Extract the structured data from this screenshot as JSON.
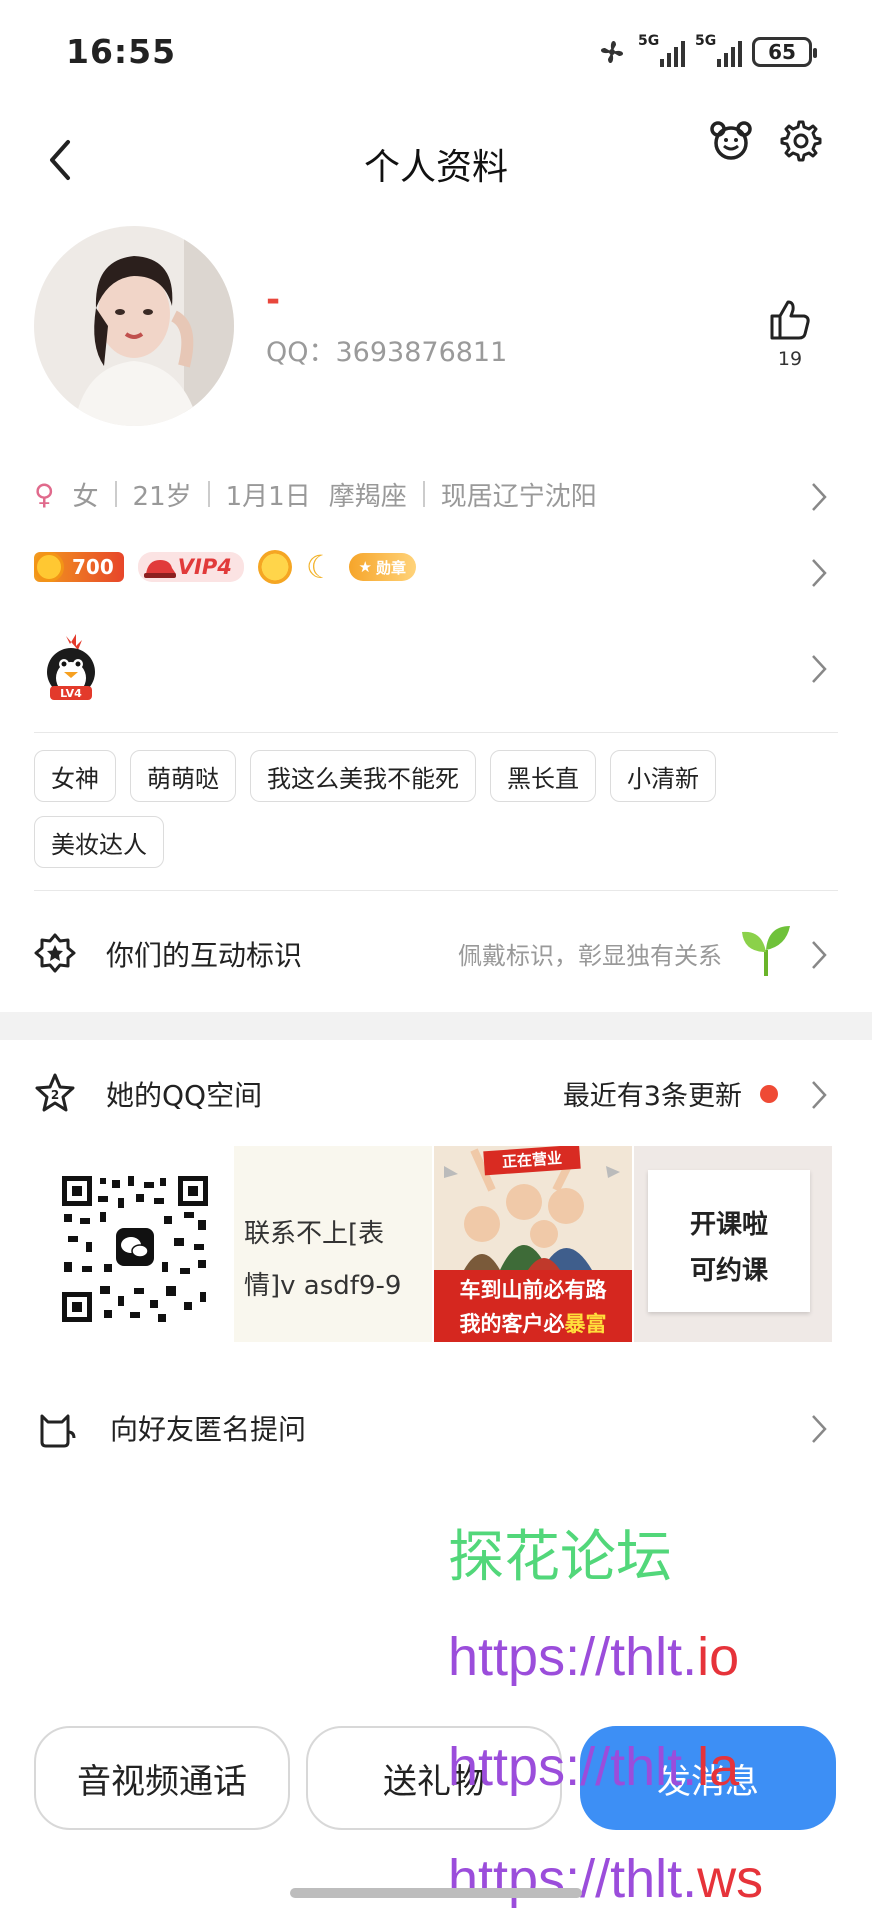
{
  "status_bar": {
    "time": "16:55",
    "network1": "5G",
    "network2": "5G",
    "battery": "65"
  },
  "nav": {
    "title": "个人资料"
  },
  "profile": {
    "name": "-",
    "qq": "QQ：3693876811",
    "like_count": "19"
  },
  "info": {
    "gender": "女",
    "age": "21岁",
    "birthday": "1月1日",
    "zodiac": "摩羯座",
    "location": "现居辽宁沈阳"
  },
  "badges": {
    "coins": "700",
    "vip": "VIP4",
    "medal": "勋章"
  },
  "penguin_level": "LV4",
  "tags": [
    "女神",
    "萌萌哒",
    "我这么美我不能死",
    "黑长直",
    "小清新",
    "美妆达人"
  ],
  "interaction": {
    "label": "你们的互动标识",
    "hint": "佩戴标识，彰显独有关系"
  },
  "qzone": {
    "label": "她的QQ空间",
    "updates": "最近有3条更新",
    "thumb2_line1": "联系不上[表",
    "thumb2_line2": "情]v  asdf9-9",
    "thumb3_banner": "正在营业",
    "thumb3_line1": "车到山前必有路",
    "thumb3_line2_a": "我的客户必",
    "thumb3_line2_b": "暴富",
    "thumb4_line1": "开课啦",
    "thumb4_line2": "可约课"
  },
  "anon_question": {
    "label": "向好友匿名提问"
  },
  "watermark": {
    "line1": "探花论坛",
    "line2a": "https://thlt.",
    "line2b": "io",
    "line3a": "https://thlt.",
    "line3b": "la",
    "line4a": "https://thlt.",
    "line4b": "ws"
  },
  "buttons": {
    "av_call": "音视频通话",
    "gift": "送礼物",
    "message": "发消息"
  },
  "colors": {
    "accent_blue": "#3d8ff5",
    "name_red": "#e8473c",
    "watermark_green": "#52d77a",
    "watermark_purple": "#9b4ddb"
  }
}
